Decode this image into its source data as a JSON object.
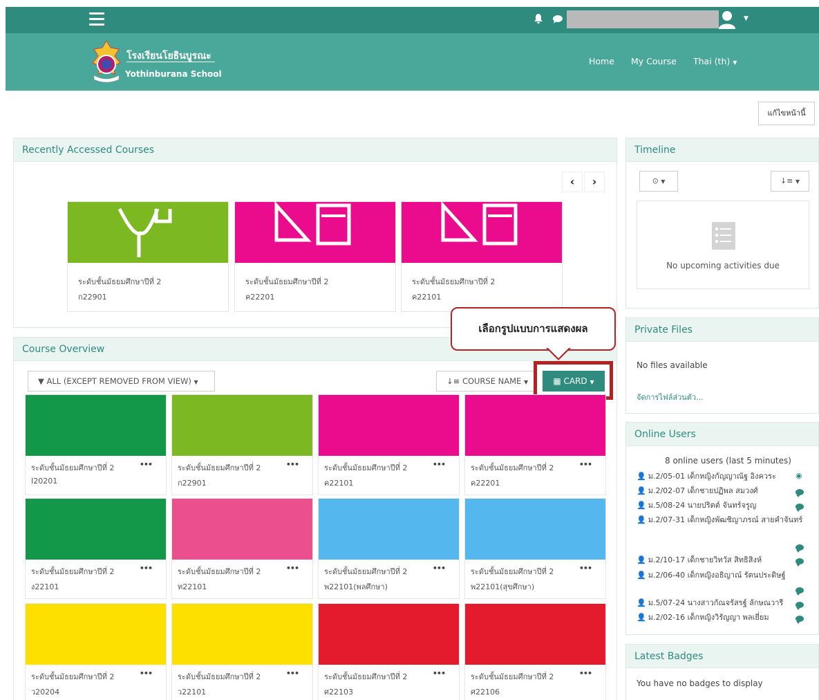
{
  "topbar": {
    "bell_icon": "bell-icon",
    "chat_icon": "chat-icon",
    "user_icon": "user-avatar-icon"
  },
  "brand": {
    "name_th": "โรงเรียนโยธินบูรณะ",
    "name_en": "Yothinburana School"
  },
  "nav": {
    "home": "Home",
    "my_course": "My Course",
    "language": "Thai (th)"
  },
  "page": {
    "edit_button": "แก้ไขหน้านี้"
  },
  "recent": {
    "title": "Recently Accessed Courses",
    "cards": [
      {
        "level": "ระดับชั้นมัธยมศึกษาปีที่ 2",
        "code": "ก22901",
        "color": "#7cb821"
      },
      {
        "level": "ระดับชั้นมัธยมศึกษาปีที่ 2",
        "code": "ค22201",
        "color": "#ea0c8c"
      },
      {
        "level": "ระดับชั้นมัธยมศึกษาปีที่ 2",
        "code": "ค22101",
        "color": "#ea0c8c"
      }
    ]
  },
  "overview": {
    "title": "Course Overview",
    "filter_label": "ALL (EXCEPT REMOVED FROM VIEW)",
    "sort_label": "COURSE NAME",
    "view_label": "CARD",
    "callout": "เลือกรูปแบบการแสดงผล",
    "courses": [
      {
        "level": "ระดับชั้นมัธยมศึกษาปีที่ 2",
        "code": "I20201",
        "color": "#129848"
      },
      {
        "level": "ระดับชั้นมัธยมศึกษาปีที่ 2",
        "code": "ก22901",
        "color": "#7cb821"
      },
      {
        "level": "ระดับชั้นมัธยมศึกษาปีที่ 2",
        "code": "ค22101",
        "color": "#ea0c8c"
      },
      {
        "level": "ระดับชั้นมัธยมศึกษาปีที่ 2",
        "code": "ค22201",
        "color": "#ea0c8c"
      },
      {
        "level": "ระดับชั้นมัธยมศึกษาปีที่ 2",
        "code": "ง22101",
        "color": "#129848"
      },
      {
        "level": "ระดับชั้นมัธยมศึกษาปีที่ 2",
        "code": "ท22101",
        "color": "#ec4f8e"
      },
      {
        "level": "ระดับชั้นมัธยมศึกษาปีที่ 2",
        "code": "พ22101(พลศึกษา)",
        "color": "#54b7ee"
      },
      {
        "level": "ระดับชั้นมัธยมศึกษาปีที่ 2",
        "code": "พ22101(สุขศึกษา)",
        "color": "#54b7ee"
      },
      {
        "level": "ระดับชั้นมัธยมศึกษาปีที่ 2",
        "code": "ว20204",
        "color": "#fde000"
      },
      {
        "level": "ระดับชั้นมัธยมศึกษาปีที่ 2",
        "code": "ว22101",
        "color": "#fde000"
      },
      {
        "level": "ระดับชั้นมัธยมศึกษาปีที่ 2",
        "code": "ศ22103",
        "color": "#e41b2c"
      },
      {
        "level": "ระดับชั้นมัธยมศึกษาปีที่ 2",
        "code": "ศ22106",
        "color": "#e41b2c"
      }
    ]
  },
  "timeline": {
    "title": "Timeline",
    "empty": "No upcoming activities due"
  },
  "private_files": {
    "title": "Private Files",
    "empty": "No files available",
    "manage": "จัดการไฟล์ส่วนตัว..."
  },
  "online_users": {
    "title": "Online Users",
    "summary": "8 online users (last 5 minutes)",
    "users": [
      "ม.2/05-01 เด็กหญิงกัญญาณัฐ อิงควระ",
      "ม.2/02-07 เด็กชายปฏิพล สมวงศ์",
      "ม.5/08-24 นายปริตต์ จันทร์จรูญ",
      "ม.2/07-31 เด็กหญิงพัฒชิญาภรณ์ สายคำจันทร์",
      "ม.2/10-17 เด็กชายวิทวัส สิทธิสิงห์",
      "ม.2/06-40 เด็กหญิงอธิญาณ์ รัตนประดิษฐ์",
      "ม.5/07-24 นางสาวกัณจรัสรฐ์ ลักษณวารี",
      "ม.2/02-16 เด็กหญิงวิรัญญา พลเยี่ยม"
    ]
  },
  "badges": {
    "title": "Latest Badges",
    "empty": "You have no badges to display"
  }
}
